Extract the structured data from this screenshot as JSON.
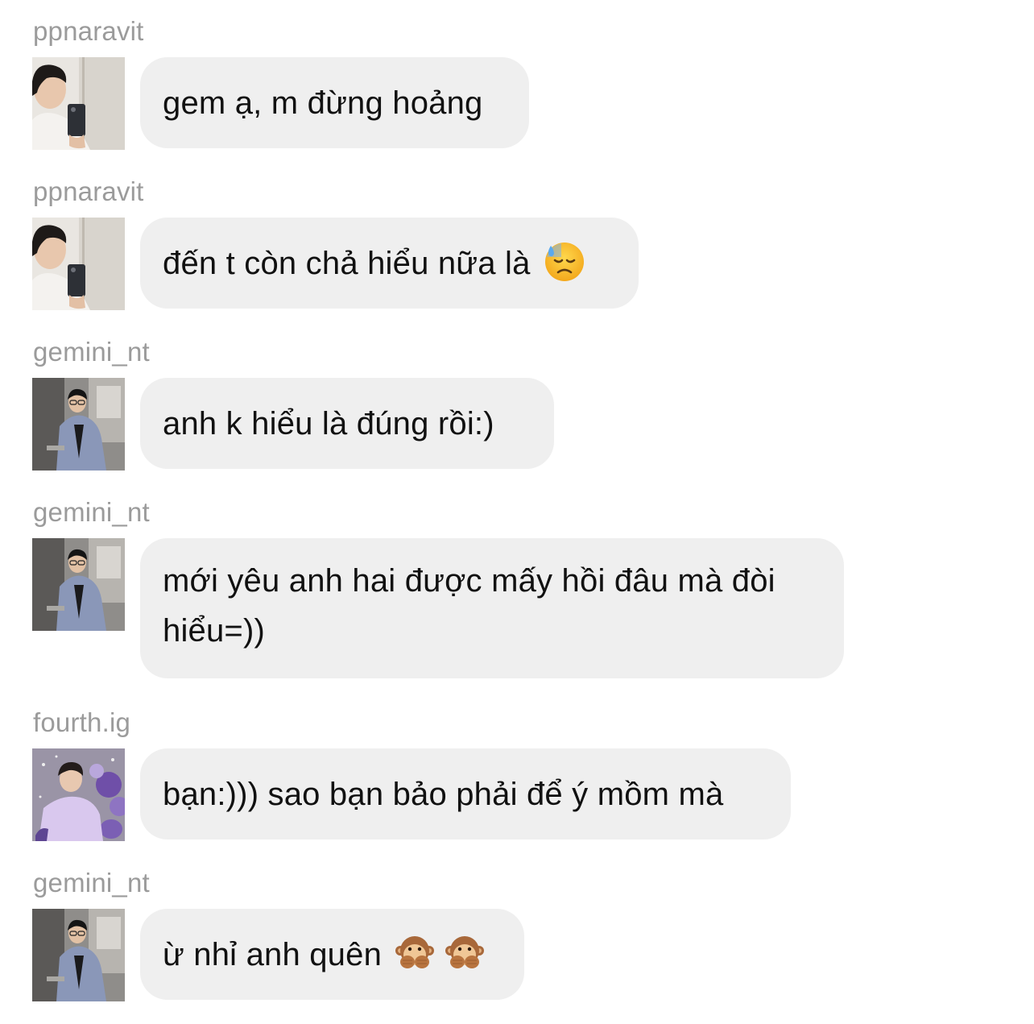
{
  "messages": [
    {
      "username": "ppnaravit",
      "text": "gem ạ, m đừng hoảng",
      "avatar": "user-photo-mirror-selfie"
    },
    {
      "username": "ppnaravit",
      "text": "đến t còn chả hiểu nữa là",
      "emoji": [
        "downcast-face-with-sweat-emoji"
      ],
      "avatar": "user-photo-mirror-selfie"
    },
    {
      "username": "gemini_nt",
      "text": "anh k hiểu là đúng rồi:)",
      "avatar": "user-photo-blue-suit"
    },
    {
      "username": "gemini_nt",
      "text_line1": "mới yêu anh hai được mấy hồi đâu mà đòi",
      "text_line2": "hiểu=))",
      "avatar": "user-photo-blue-suit"
    },
    {
      "username": "fourth.ig",
      "text": "bạn:))) sao bạn bảo phải để ý mồm mà",
      "avatar": "user-photo-purple-balloons"
    },
    {
      "username": "gemini_nt",
      "text": "ừ nhỉ anh quên",
      "emoji": [
        "speak-no-evil-monkey-emoji",
        "speak-no-evil-monkey-emoji"
      ],
      "avatar": "user-photo-blue-suit"
    }
  ],
  "colors": {
    "bubble": "#efefef",
    "username": "#9b9b9b",
    "text": "#111111"
  }
}
